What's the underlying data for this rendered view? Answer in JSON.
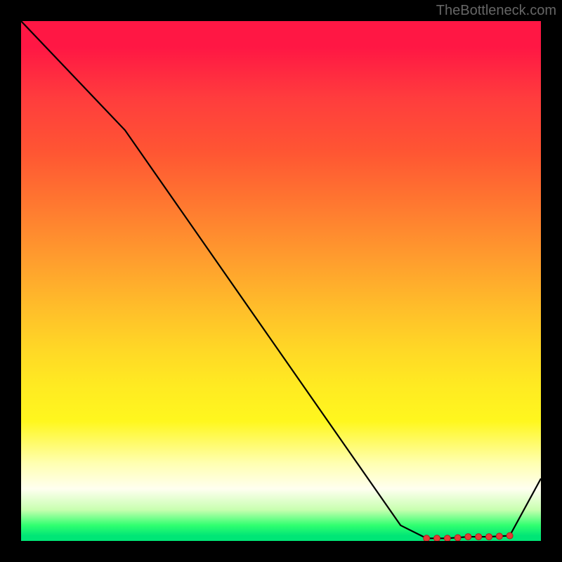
{
  "watermark": "TheBottleneck.com",
  "chart_data": {
    "type": "line",
    "title": "",
    "xlabel": "",
    "ylabel": "",
    "xlim": [
      0,
      100
    ],
    "ylim": [
      0,
      100
    ],
    "series": [
      {
        "name": "curve",
        "x": [
          0,
          20,
          73,
          78,
          82,
          86,
          90,
          94,
          100
        ],
        "values": [
          100,
          79,
          3,
          0.5,
          0.5,
          0.8,
          0.8,
          1,
          12
        ]
      }
    ],
    "markers": {
      "name": "highlight-points",
      "x": [
        78,
        80,
        82,
        84,
        86,
        88,
        90,
        92,
        94
      ],
      "values": [
        0.5,
        0.5,
        0.5,
        0.6,
        0.8,
        0.8,
        0.8,
        0.9,
        1.0
      ]
    },
    "gradient_stops": [
      {
        "pos": 0.0,
        "color": "#ff1744"
      },
      {
        "pos": 0.5,
        "color": "#ffb300"
      },
      {
        "pos": 0.78,
        "color": "#fff176"
      },
      {
        "pos": 0.92,
        "color": "#f0f4c3"
      },
      {
        "pos": 1.0,
        "color": "#00e676"
      }
    ]
  }
}
